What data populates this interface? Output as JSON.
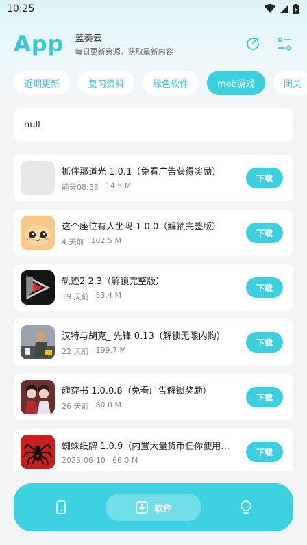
{
  "status_bar": {
    "time": "10:25"
  },
  "header": {
    "logo": "App",
    "title": "蓝奏云",
    "subtitle": "每日更新资源，获取最新内容"
  },
  "tabs": [
    {
      "label": "近期更新"
    },
    {
      "label": "复习资料"
    },
    {
      "label": "绿色软件"
    },
    {
      "label": "mob游戏"
    },
    {
      "label": "闭关"
    }
  ],
  "active_tab": "mob游戏",
  "notice": {
    "text": "null"
  },
  "download_label": "下载",
  "apps": [
    {
      "title": "抓住那道光 1.0.1（免看广告获得奖励）",
      "date": "前天08:58",
      "size": "14.5 M",
      "icon": "placeholder-icon"
    },
    {
      "title": "这个座位有人坐吗 1.0.0（解锁完整版）",
      "date": "4 天前",
      "size": "102.5 M",
      "icon": "cute-face-icon"
    },
    {
      "title": "轨迹2 2.3（解锁完整版）",
      "date": "19 天前",
      "size": "53.4 M",
      "icon": "play-triangle-icon"
    },
    {
      "title": "汉特与胡克_ 先锋 0.13（解锁无限内购）",
      "date": "22 天前",
      "size": "199.7 M",
      "icon": "soldier-icon"
    },
    {
      "title": "趣穿书 1.0.0.8（免看广告解锁奖励）",
      "date": "26 天前",
      "size": "80.0 M",
      "icon": "characters-icon"
    },
    {
      "title": "蜘蛛纸牌 1.0.9（内置大量货币任你使用…",
      "date": "2025-06-10",
      "size": "66.0 M",
      "icon": "spider-icon"
    }
  ],
  "bottom_nav": {
    "center_label": "软件"
  },
  "colors": {
    "accent": "#3ccfe0",
    "logo": "#3cc6d6"
  }
}
